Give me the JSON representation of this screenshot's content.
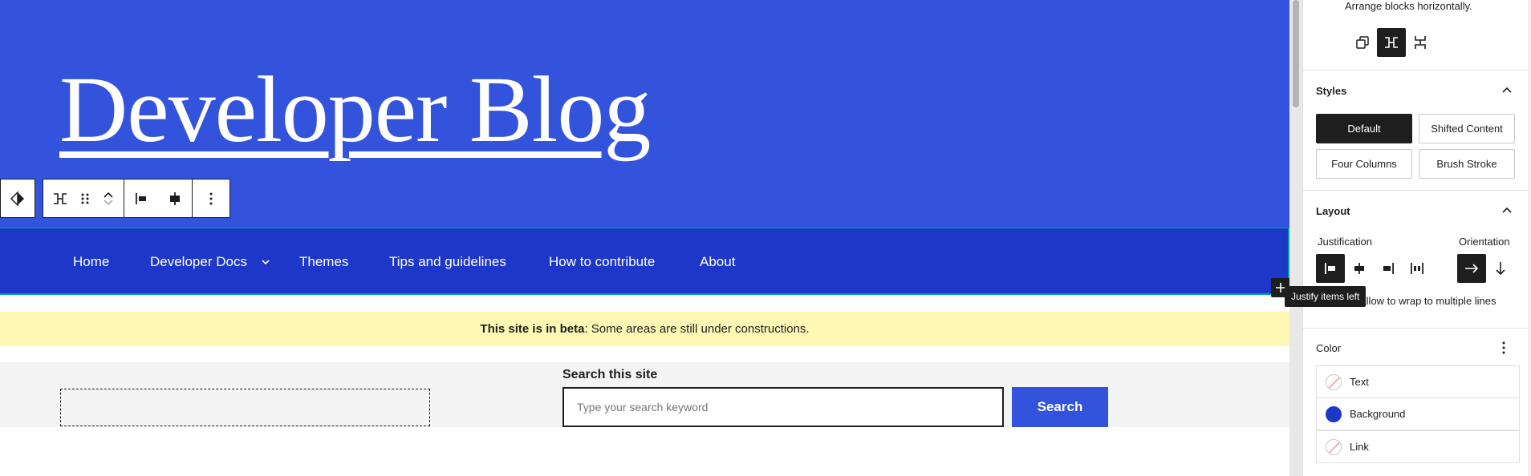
{
  "canvas": {
    "site_title": "Developer Blog",
    "nav": {
      "items": [
        "Home",
        "Developer Docs",
        "Themes",
        "Tips and guidelines",
        "How to contribute",
        "About"
      ]
    },
    "beta_banner": {
      "bold_text": "This site is in beta",
      "text": ": Some areas are still under constructions."
    },
    "search": {
      "label": "Search this site",
      "placeholder": "Type your search keyword",
      "button_label": "Search"
    }
  },
  "sidebar": {
    "layout_variation": {
      "description": "Arrange blocks horizontally.",
      "active": "row"
    },
    "styles": {
      "title": "Styles",
      "options": [
        "Default",
        "Shifted Content",
        "Four Columns",
        "Brush Stroke"
      ],
      "active": "Default"
    },
    "layout": {
      "title": "Layout",
      "justification_label": "Justification",
      "orientation_label": "Orientation",
      "justification_active": "left",
      "orientation_active": "horizontal",
      "wrap_label": "Allow to wrap to multiple lines",
      "tooltip": "Justify items left"
    },
    "color": {
      "title": "Color",
      "items": [
        {
          "label": "Text",
          "color": ""
        },
        {
          "label": "Background",
          "color": "#1d37c9"
        },
        {
          "label": "Link",
          "color": ""
        }
      ]
    }
  },
  "colors": {
    "header_blue": "#3353dd",
    "nav_blue": "#1d37c9",
    "banner_yellow": "#fff8b4",
    "selection_teal": "#00a0a4"
  }
}
